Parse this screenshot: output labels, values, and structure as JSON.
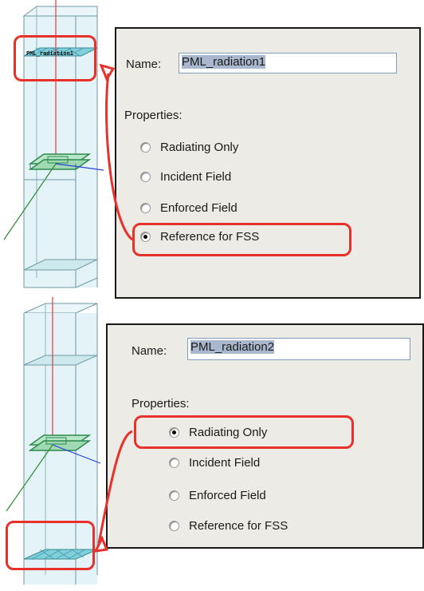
{
  "panels": [
    {
      "name_label": "Name:",
      "name_value": "PML_radiation1",
      "properties_label": "Properties:",
      "options": [
        "Radiating Only",
        "Incident Field",
        "Enforced Field",
        "Reference for FSS"
      ],
      "selected_option": "Reference for FSS"
    },
    {
      "name_label": "Name:",
      "name_value": "PML_radiation2",
      "properties_label": "Properties:",
      "options": [
        "Radiating Only",
        "Incident Field",
        "Enforced Field",
        "Reference for FSS"
      ],
      "selected_option": "Radiating Only"
    }
  ],
  "model_label_top": "PML_radiation1",
  "colors": {
    "highlight": "#e8312a",
    "panel_bg": "#ecebe6",
    "column_fill": "#d6eef3",
    "column_edge": "#6f9aa6",
    "z_axis": "#e33a3a",
    "x_axis": "#2a3fd6",
    "y_axis": "#2c8a2c",
    "pml_fill": "#7fd0db"
  }
}
